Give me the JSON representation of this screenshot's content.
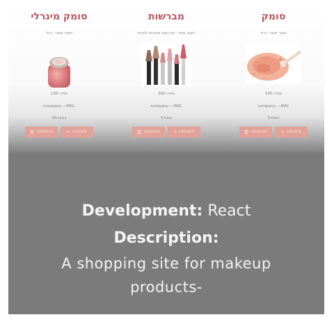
{
  "cards": [
    {
      "title": "סומק מינרלי",
      "desc": "תאור מוצר: ורוד",
      "price": "מחיר:195",
      "company": "company----MAC",
      "amount": "כמות:59",
      "remove_label": "REMOVE",
      "update_label": "UPDATE",
      "image": "blush-pot-image"
    },
    {
      "title": "מברשות",
      "desc": "תאור מוצר: מברשות מעיינות לפנים",
      "price": "מחיר:360",
      "company": "company----MAC",
      "amount": "כמות:3",
      "remove_label": "REMOVE",
      "update_label": "UPDATE",
      "image": "brushes-image"
    },
    {
      "title": "סומק",
      "desc": "תאור מוצר: ורוד",
      "price": "מחיר:195",
      "company": "company----MAC",
      "amount": "כמות:5",
      "remove_label": "REMOVE",
      "update_label": "UPDATE",
      "image": "blush-powder-image"
    }
  ],
  "overlay": {
    "dev_label": "Development:",
    "dev_value": "React",
    "desc_label": "Description:",
    "desc_line1": "A shopping site for makeup",
    "desc_line2": "products-"
  },
  "colors": {
    "title": "#b8555f",
    "button": "#e2a299",
    "overlay_bg": "#7b7b7b"
  }
}
